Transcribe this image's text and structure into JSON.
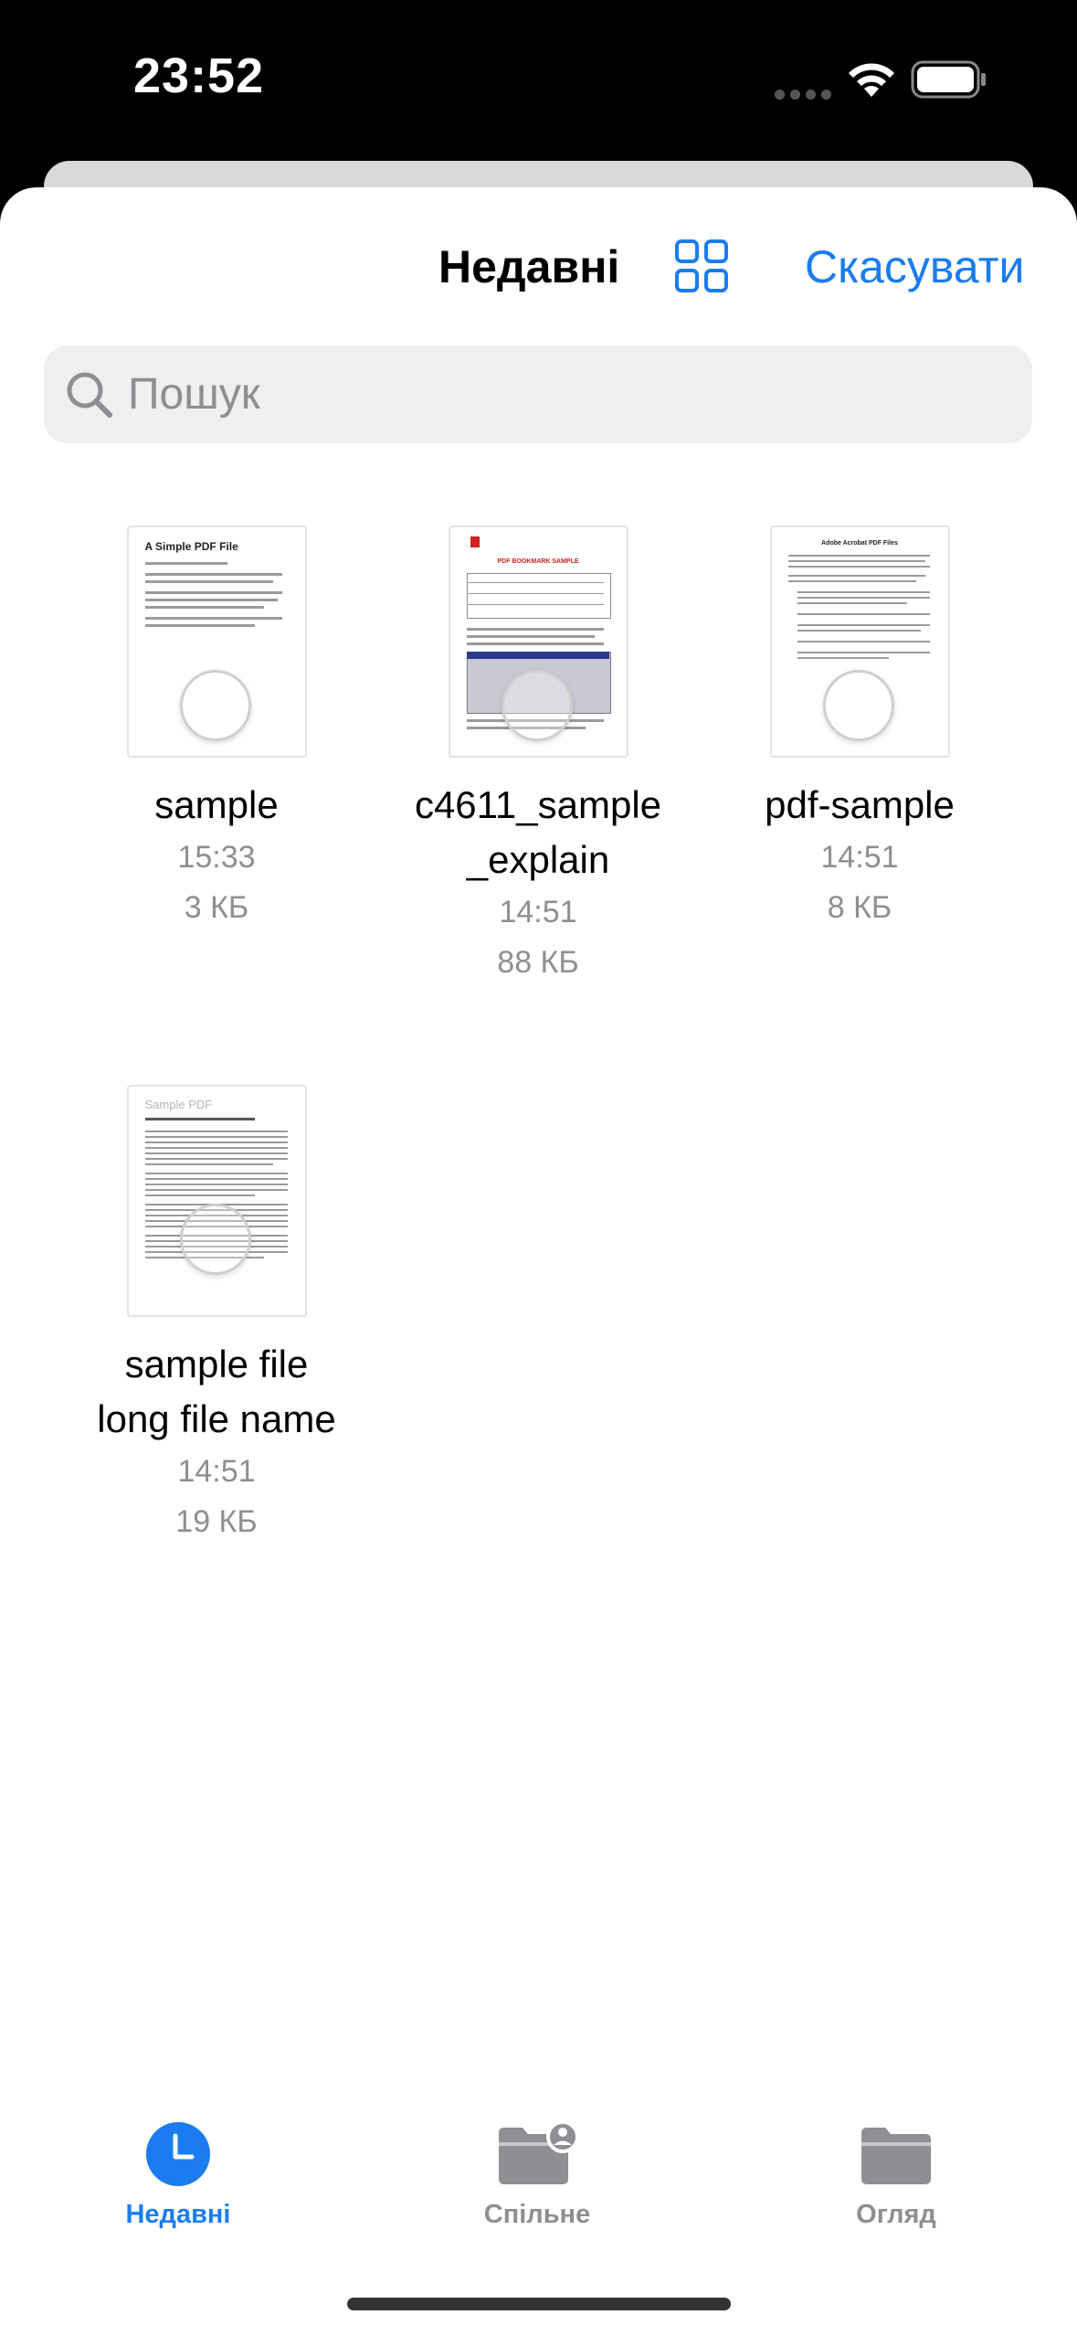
{
  "status_bar": {
    "time": "23:52"
  },
  "header": {
    "title": "Недавні",
    "cancel_label": "Скасувати"
  },
  "search": {
    "placeholder": "Пошук",
    "value": ""
  },
  "files": [
    {
      "name": "sample",
      "time": "15:33",
      "size": "3 КБ",
      "thumb_title": "A Simple PDF File"
    },
    {
      "name": "c4611_sample _explain",
      "name_line1": "c4611_sample",
      "name_line2": "_explain",
      "time": "14:51",
      "size": "88 КБ",
      "thumb_title": "PDF BOOKMARK SAMPLE"
    },
    {
      "name": "pdf-sample",
      "time": "14:51",
      "size": "8 КБ",
      "thumb_title": "Adobe Acrobat PDF Files"
    },
    {
      "name": "sample file long file name",
      "name_line1": "sample file",
      "name_line2": "long file name",
      "time": "14:51",
      "size": "19 КБ",
      "thumb_title": "Sample PDF"
    }
  ],
  "tab_bar": {
    "items": [
      {
        "label": "Недавні",
        "icon": "clock-icon",
        "active": true
      },
      {
        "label": "Спільне",
        "icon": "shared-folder-icon",
        "active": false
      },
      {
        "label": "Огляд",
        "icon": "folder-icon",
        "active": false
      }
    ]
  },
  "colors": {
    "accent": "#1a7cf0",
    "inactive_tab": "#8e8e93",
    "meta_text": "#8e8e93"
  }
}
